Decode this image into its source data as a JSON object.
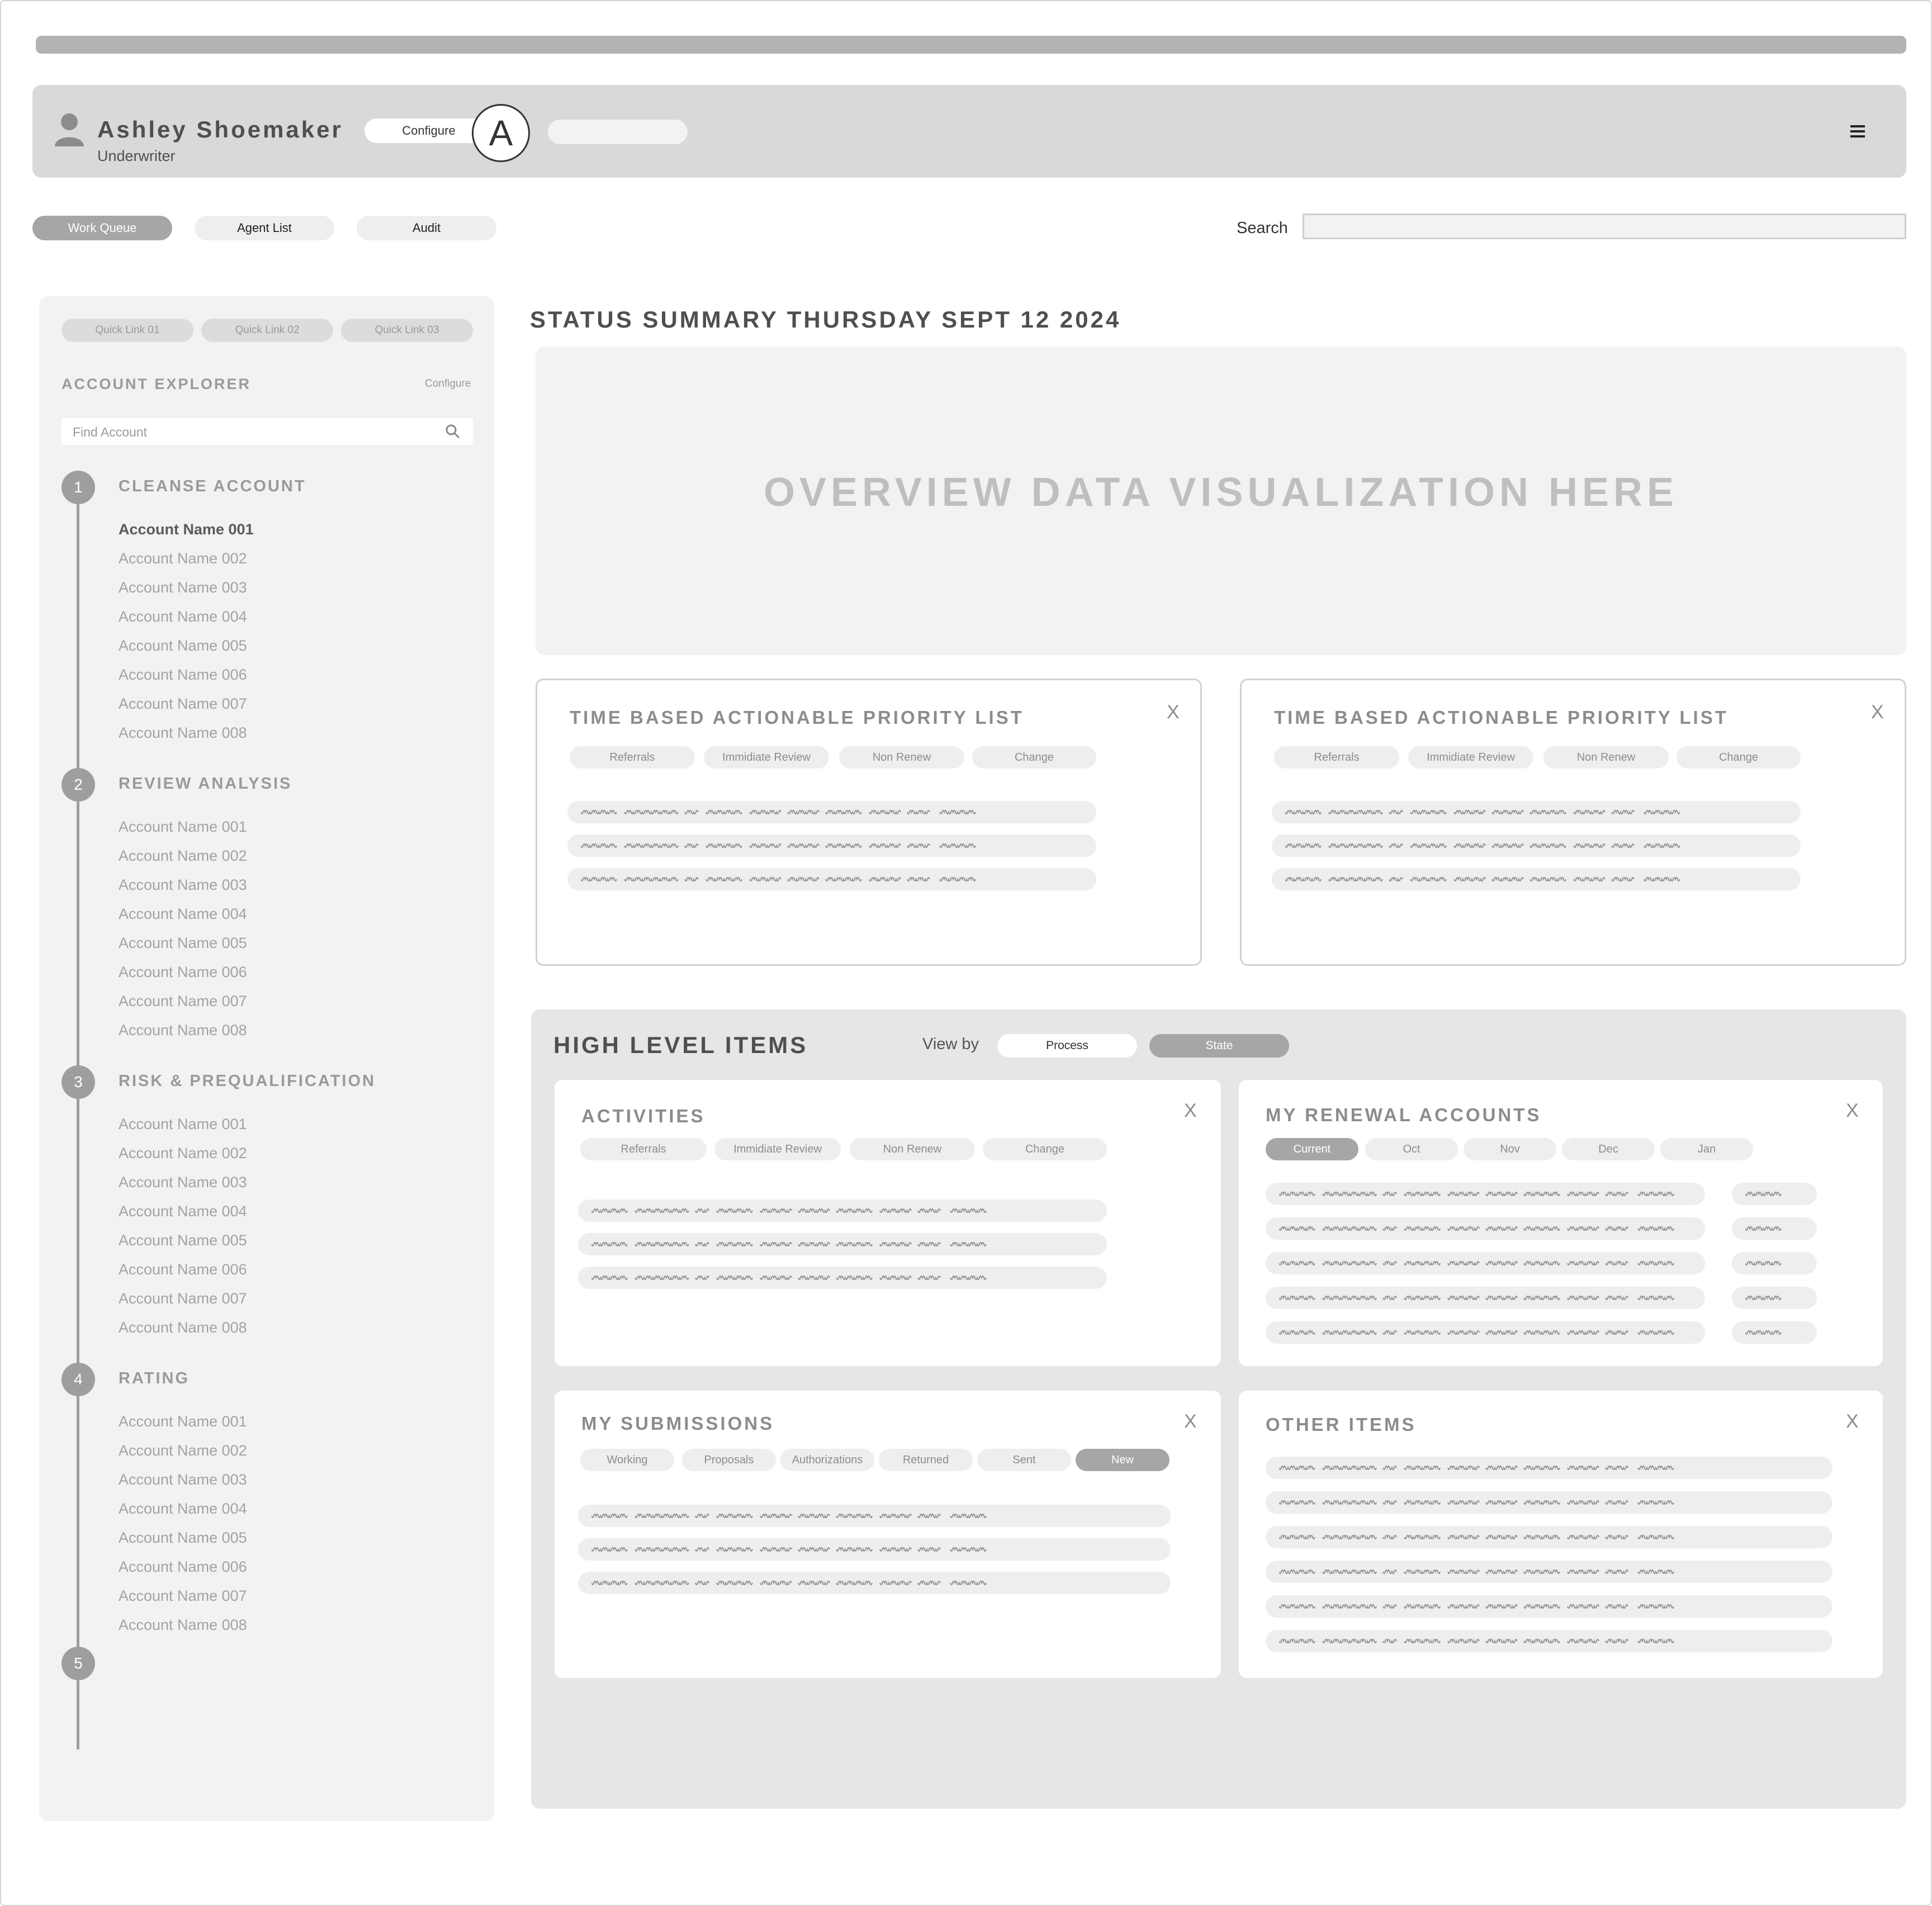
{
  "header": {
    "user_name": "Ashley Shoemaker",
    "user_role": "Underwriter",
    "configure_label": "Configure",
    "avatar_letter": "A",
    "icons": [
      "user-icon",
      "menu-icon"
    ]
  },
  "nav": {
    "tabs": [
      {
        "label": "Work Queue",
        "active": true
      },
      {
        "label": "Agent List",
        "active": false
      },
      {
        "label": "Audit",
        "active": false
      }
    ],
    "search_label": "Search",
    "search_value": ""
  },
  "sidebar": {
    "quick_links": [
      "Quick Link 01",
      "Quick Link 02",
      "Quick Link 03"
    ],
    "title": "ACCOUNT EXPLORER",
    "configure_label": "Configure",
    "find_placeholder": "Find Account",
    "steps": [
      {
        "number": "1",
        "title": "CLEANSE ACCOUNT",
        "accounts": [
          "Account Name 001",
          "Account Name 002",
          "Account Name 003",
          "Account Name 004",
          "Account Name 005",
          "Account Name 006",
          "Account Name 007",
          "Account Name 008"
        ],
        "selected": 0
      },
      {
        "number": "2",
        "title": "REVIEW ANALYSIS",
        "accounts": [
          "Account Name 001",
          "Account Name 002",
          "Account Name 003",
          "Account Name 004",
          "Account Name 005",
          "Account Name 006",
          "Account Name 007",
          "Account Name 008"
        ]
      },
      {
        "number": "3",
        "title": "RISK & PREQUALIFICATION",
        "accounts": [
          "Account Name 001",
          "Account Name 002",
          "Account Name 003",
          "Account Name 004",
          "Account Name 005",
          "Account Name 006",
          "Account Name 007",
          "Account Name 008"
        ]
      },
      {
        "number": "4",
        "title": "RATING",
        "accounts": [
          "Account Name 001",
          "Account Name 002",
          "Account Name 003",
          "Account Name 004",
          "Account Name 005",
          "Account Name 006",
          "Account Name 007",
          "Account Name 008"
        ]
      },
      {
        "number": "5",
        "title": "",
        "accounts": []
      }
    ]
  },
  "main": {
    "status_title": "STATUS SUMMARY THURSDAY SEPT 12 2024",
    "overview_placeholder": "OVERVIEW DATA VISUALIZATION HERE",
    "priority_cards": [
      {
        "title": "TIME BASED ACTIONABLE PRIORITY LIST",
        "close": "X",
        "chips": [
          "Referrals",
          "Immidiate Review",
          "Non Renew",
          "Change"
        ]
      },
      {
        "title": "TIME BASED ACTIONABLE PRIORITY LIST",
        "close": "X",
        "chips": [
          "Referrals",
          "Immidiate Review",
          "Non Renew",
          "Change"
        ]
      }
    ],
    "high_level": {
      "title": "HIGH LEVEL ITEMS",
      "view_by_label": "View by",
      "view_by_options": [
        {
          "label": "Process",
          "active": false
        },
        {
          "label": "State",
          "active": true
        }
      ],
      "activities": {
        "title": "ACTIVITIES",
        "close": "X",
        "chips": [
          "Referrals",
          "Immidiate Review",
          "Non Renew",
          "Change"
        ]
      },
      "renewals": {
        "title": "MY RENEWAL  ACCOUNTS",
        "close": "X",
        "chips": [
          {
            "label": "Current",
            "active": true
          },
          {
            "label": "Oct",
            "active": false
          },
          {
            "label": "Nov",
            "active": false
          },
          {
            "label": "Dec",
            "active": false
          },
          {
            "label": "Jan",
            "active": false
          }
        ]
      },
      "submissions": {
        "title": "MY SUBMISSIONS",
        "close": "X",
        "chips": [
          {
            "label": "Working",
            "active": false
          },
          {
            "label": "Proposals",
            "active": false
          },
          {
            "label": "Authorizations",
            "active": false
          },
          {
            "label": "Returned",
            "active": false
          },
          {
            "label": "Sent",
            "active": false
          },
          {
            "label": "New",
            "active": true
          }
        ]
      },
      "other": {
        "title": "OTHER ITEMS",
        "close": "X"
      }
    }
  },
  "colors": {
    "accent_gray": "#a6a6a6",
    "panel_gray": "#e6e6e6",
    "header_gray": "#d9d9d9"
  }
}
